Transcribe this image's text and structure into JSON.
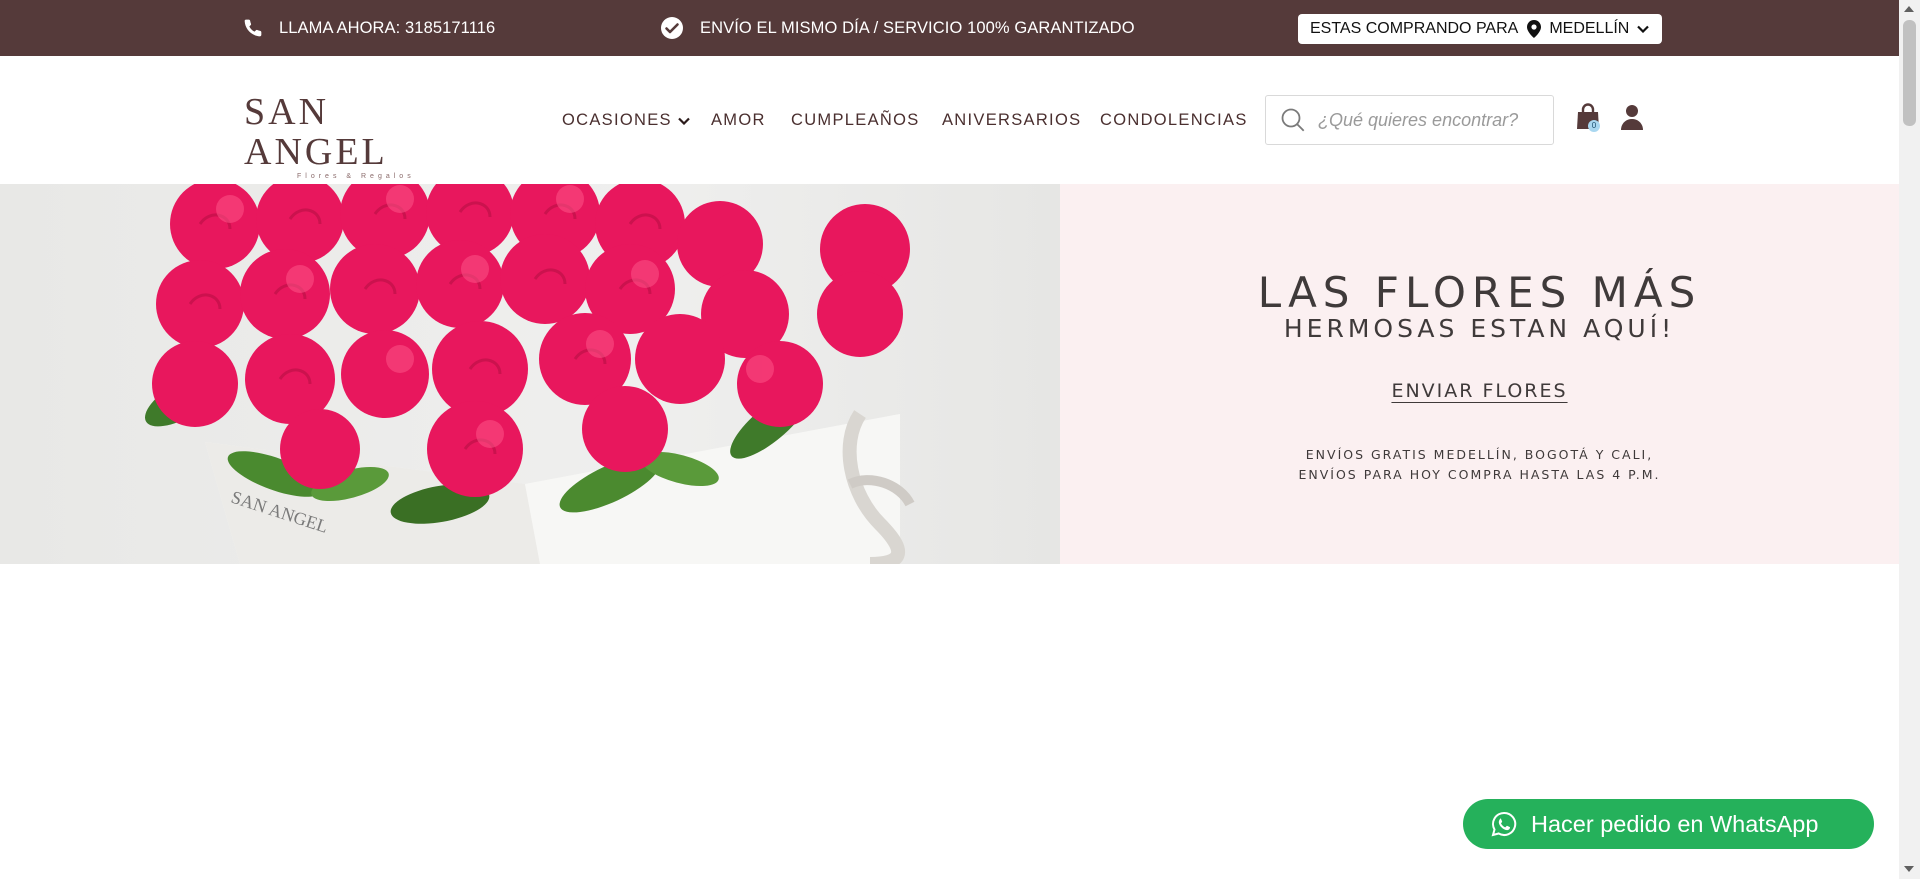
{
  "topbar": {
    "call_text": "LLAMA AHORA: 3185171116",
    "shipping_text": "ENVÍO EL MISMO DÍA / SERVICIO 100% GARANTIZADO",
    "location_prefix": "ESTAS COMPRANDO PARA",
    "location_city": "MEDELLÍN",
    "background": "#553a3a"
  },
  "header": {
    "logo_name": "SAN ANGEL",
    "logo_tagline": "Flores & Regalos",
    "nav": [
      "OCASIONES",
      "AMOR",
      "CUMPLEAÑOS",
      "ANIVERSARIOS",
      "CONDOLENCIAS"
    ],
    "search_placeholder": "¿Qué quieres encontrar?",
    "cart_count": "0"
  },
  "hero": {
    "title_line1": "LAS FLORES MÁS",
    "title_line2": "HERMOSAS ESTAN AQUÍ!",
    "cta": "ENVIAR FLORES",
    "note_line1": "ENVÍOS GRATIS MEDELLÍN, BOGOTÁ Y CALI,",
    "note_line2": "ENVÍOS PARA HOY COMPRA HASTA LAS 4 P.M.",
    "image_brand_text": "SAN ANGEL",
    "panel_color": "#fbf0f1",
    "rose_color": "#e8175d"
  },
  "whatsapp": {
    "label": "Hacer pedido en WhatsApp",
    "color": "#25b15b"
  }
}
